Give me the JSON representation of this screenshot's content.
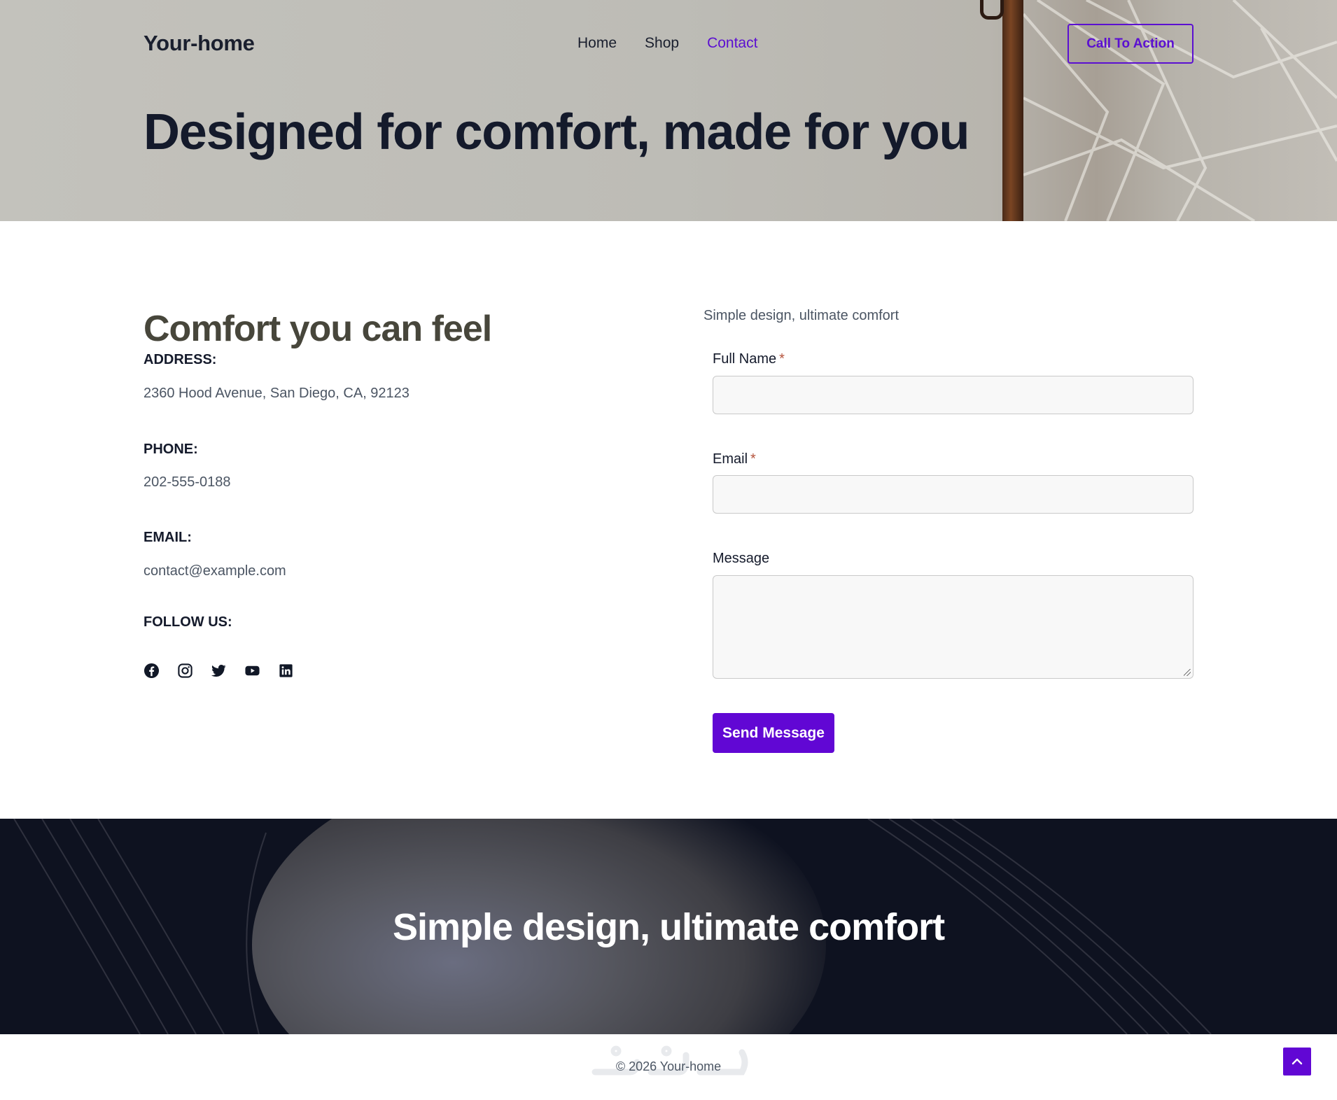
{
  "header": {
    "logo": "Your-home",
    "nav": [
      {
        "label": "Home",
        "active": false
      },
      {
        "label": "Shop",
        "active": false
      },
      {
        "label": "Contact",
        "active": true
      }
    ],
    "cta_label": "Call To Action"
  },
  "hero": {
    "title": "Designed for comfort, made for you"
  },
  "contact": {
    "heading": "Comfort you can feel",
    "address_label": "ADDRESS:",
    "address_value": "2360 Hood Avenue, San Diego, CA, 92123",
    "phone_label": "PHONE:",
    "phone_value": "202-555-0188",
    "email_label": "EMAIL:",
    "email_value": "contact@example.com",
    "follow_label": "FOLLOW US:",
    "socials": [
      "facebook-icon",
      "instagram-icon",
      "twitter-icon",
      "youtube-icon",
      "linkedin-icon"
    ]
  },
  "form": {
    "intro": "Simple design, ultimate comfort",
    "full_name_label": "Full Name",
    "email_label": "Email",
    "message_label": "Message",
    "required_marker": "*",
    "full_name_value": "",
    "email_value": "",
    "message_value": "",
    "submit_label": "Send Message"
  },
  "banner": {
    "title": "Simple design, ultimate comfort"
  },
  "footer": {
    "copyright": "© 2026 Your-home"
  },
  "colors": {
    "accent": "#6107d4",
    "heading_dark": "#141a2b",
    "heading_olive": "#47463b",
    "banner_bg": "#0e1220"
  }
}
